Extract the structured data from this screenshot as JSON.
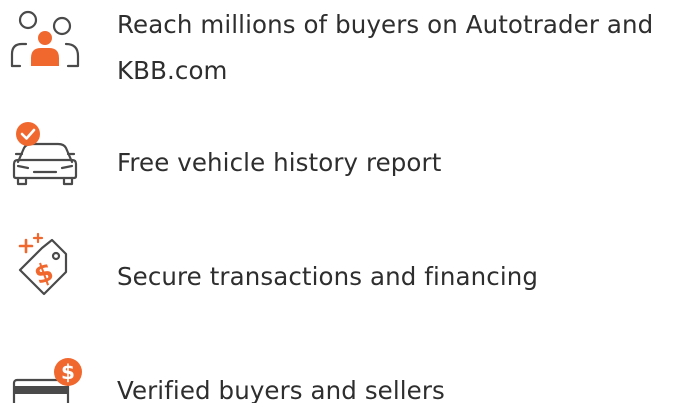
{
  "colors": {
    "accent": "#f1682f",
    "icon_stroke": "#4a4a4a",
    "text": "#2e2e2e"
  },
  "features": [
    {
      "icon": "buyers-group-icon",
      "lines": [
        "Reach millions of buyers on Autotrader and",
        "KBB.com"
      ]
    },
    {
      "icon": "car-check-icon",
      "lines": [
        "Free vehicle history report"
      ]
    },
    {
      "icon": "dollar-tag-icon",
      "lines": [
        "Secure transactions and financing"
      ]
    },
    {
      "icon": "card-dollar-icon",
      "lines": [
        "Verified buyers and sellers"
      ]
    }
  ]
}
